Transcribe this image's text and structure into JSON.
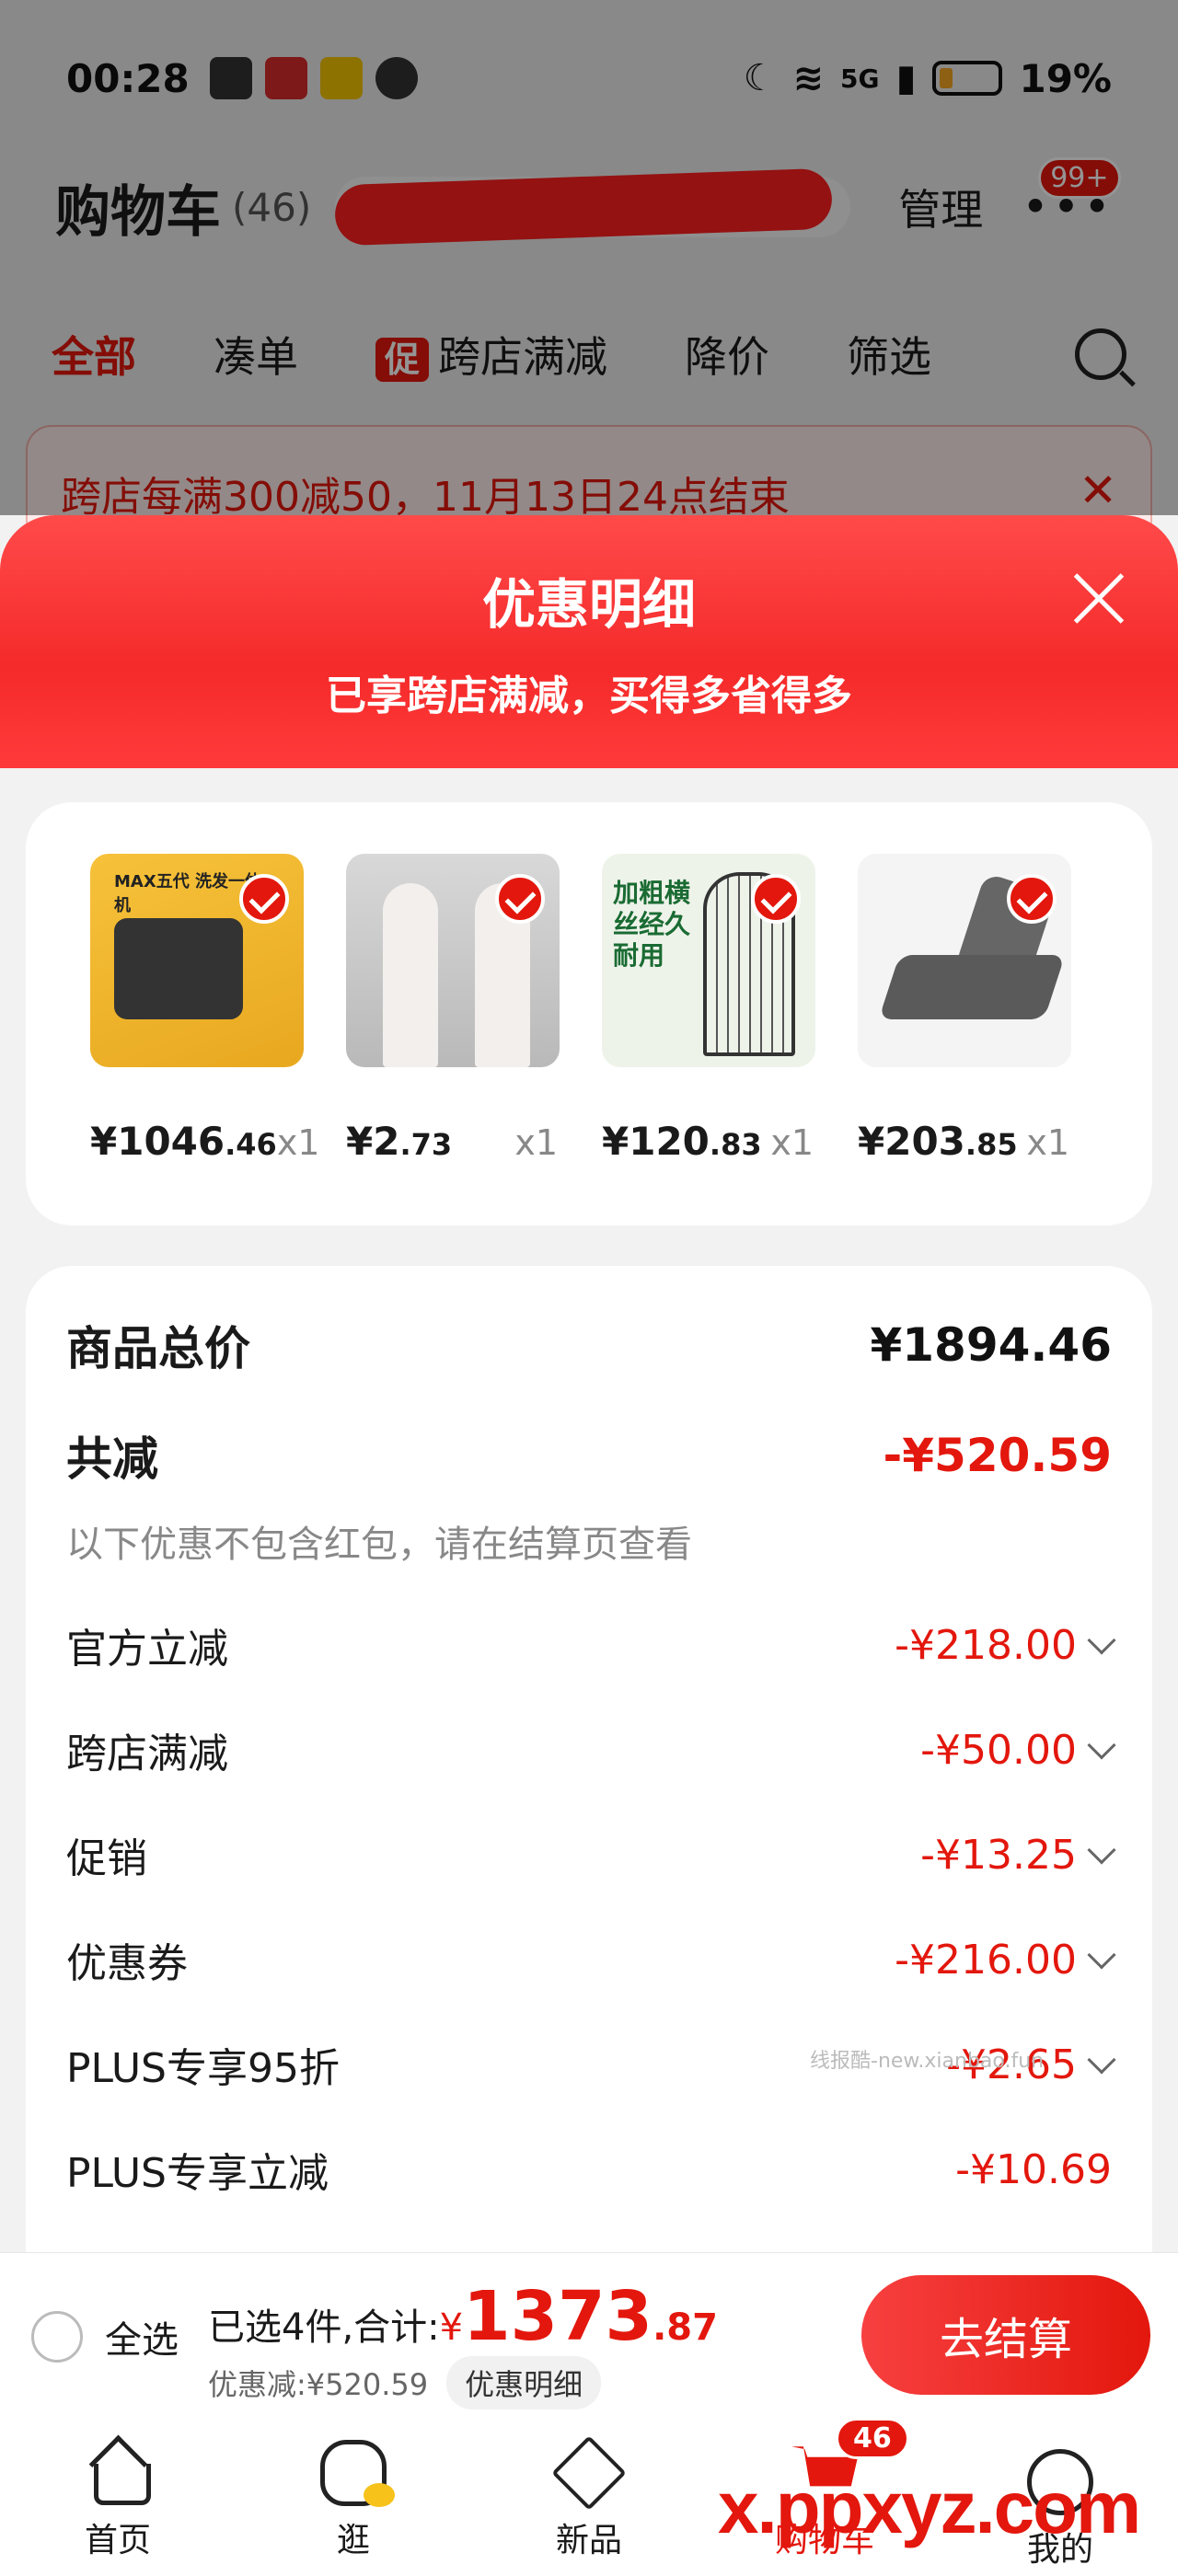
{
  "status_bar": {
    "time": "00:28",
    "network": "5G",
    "battery": "19%",
    "battery_level": 0.19
  },
  "cart": {
    "title": "购物车",
    "count": "(46)",
    "manage": "管理",
    "more_badge": "99+",
    "tabs": [
      {
        "label": "全部",
        "active": true
      },
      {
        "label": "凑单",
        "active": false
      },
      {
        "label": "跨店满减",
        "tag": "促",
        "active": false
      },
      {
        "label": "降价",
        "active": false
      },
      {
        "label": "筛选",
        "active": false
      }
    ],
    "promo_banner": "跨店每满300减50，11月13日24点结束"
  },
  "modal": {
    "title": "优惠明细",
    "subtitle": "已享跨店满减，买得多省得多",
    "products": [
      {
        "price_int": "¥1046",
        "price_dec": ".46",
        "qty": "x1",
        "thumb_text": "MAX五代 洗发一体机"
      },
      {
        "price_int": "¥2",
        "price_dec": ".73",
        "qty": "x1"
      },
      {
        "price_int": "¥120",
        "price_dec": ".83",
        "qty": "x1",
        "thumb_text": "加粗横丝经久耐用"
      },
      {
        "price_int": "¥203",
        "price_dec": ".85",
        "qty": "x1"
      }
    ],
    "summary": {
      "total_label": "商品总价",
      "total_value": "¥1894.46",
      "reduce_label": "共减",
      "reduce_value": "-¥520.59",
      "note": "以下优惠不包含红包，请在结算页查看",
      "rows": [
        {
          "label": "官方立减",
          "value": "-¥218.00",
          "expandable": true
        },
        {
          "label": "跨店满减",
          "value": "-¥50.00",
          "expandable": true
        },
        {
          "label": "促销",
          "value": "-¥13.25",
          "expandable": true
        },
        {
          "label": "优惠券",
          "value": "-¥216.00",
          "expandable": true
        },
        {
          "label": "PLUS专享95折",
          "value": "-¥2.65",
          "expandable": true
        },
        {
          "label": "PLUS专享立减",
          "value": "-¥10.69",
          "expandable": false
        }
      ],
      "watermark": "线报酷-new.xianbao.fun"
    }
  },
  "checkout": {
    "select_all": "全选",
    "selected_label": "已选4件,合计:",
    "currency": "¥",
    "total_int": "1373",
    "total_dec": ".87",
    "discount_text": "优惠减:¥520.59",
    "detail_button": "优惠明细",
    "checkout_button": "去结算"
  },
  "bottom_nav": [
    {
      "label": "首页",
      "icon": "home-icon",
      "active": false
    },
    {
      "label": "逛",
      "icon": "stroll-icon",
      "active": false
    },
    {
      "label": "新品",
      "icon": "new-product-icon",
      "active": false
    },
    {
      "label": "购物车",
      "icon": "cart-icon",
      "active": true,
      "badge": "46"
    },
    {
      "label": "我的",
      "icon": "me-icon",
      "active": false
    }
  ],
  "watermark_brand": "x.ppxyz.com"
}
